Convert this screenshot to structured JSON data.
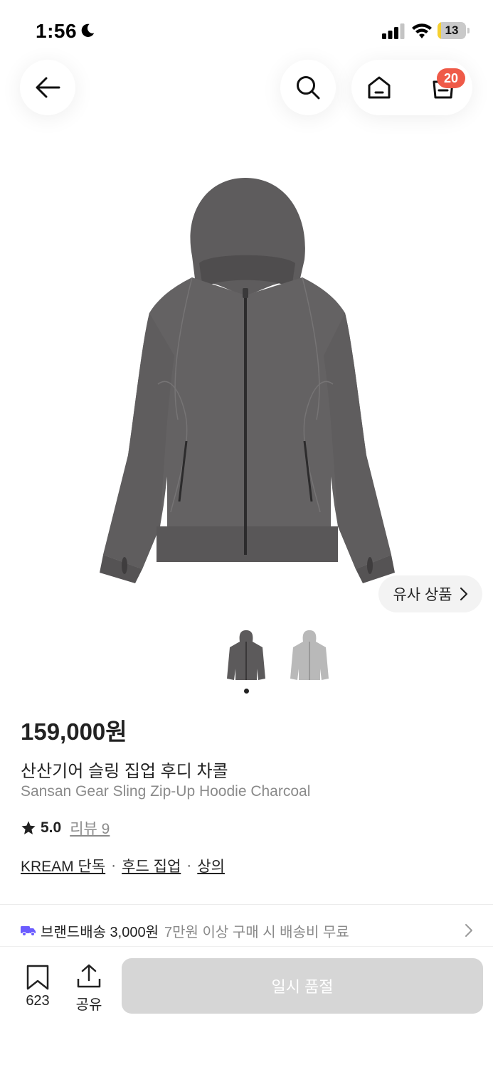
{
  "status_bar": {
    "time": "1:56",
    "battery_level": "13",
    "battery_fraction": 0.13,
    "icons": [
      "moon-icon",
      "signal-icon",
      "wifi-icon",
      "battery-icon"
    ]
  },
  "top_nav": {
    "icons": [
      "back-arrow-icon",
      "search-icon",
      "home-icon",
      "shopping-bag-icon"
    ],
    "cart_badge": "20",
    "badge_color": "#ef5a48"
  },
  "gallery": {
    "similar_label": "유사 상품",
    "thumbnail_count": 2,
    "selected_index": 0,
    "thumbnail_colors": [
      "#5c5a5b",
      "#b9b9b9"
    ]
  },
  "product": {
    "price": "159,000원",
    "name_ko": "산산기어 슬링 집업 후디 차콜",
    "name_en": "Sansan Gear Sling Zip-Up Hoodie Charcoal",
    "rating": "5.0",
    "review_label": "리뷰 9",
    "tags": [
      "KREAM 단독",
      "후드 집업",
      "상의"
    ],
    "tag_separator": "·"
  },
  "shipping": {
    "label": "브랜드배송 3,000원",
    "description": "7만원 이상 구매 시 배송비 무료",
    "icon_color": "#6b5cff"
  },
  "bottom_bar": {
    "bookmark_count": "623",
    "share_label": "공유",
    "main_button": "일시 품절",
    "main_button_color": "#d6d6d6"
  }
}
